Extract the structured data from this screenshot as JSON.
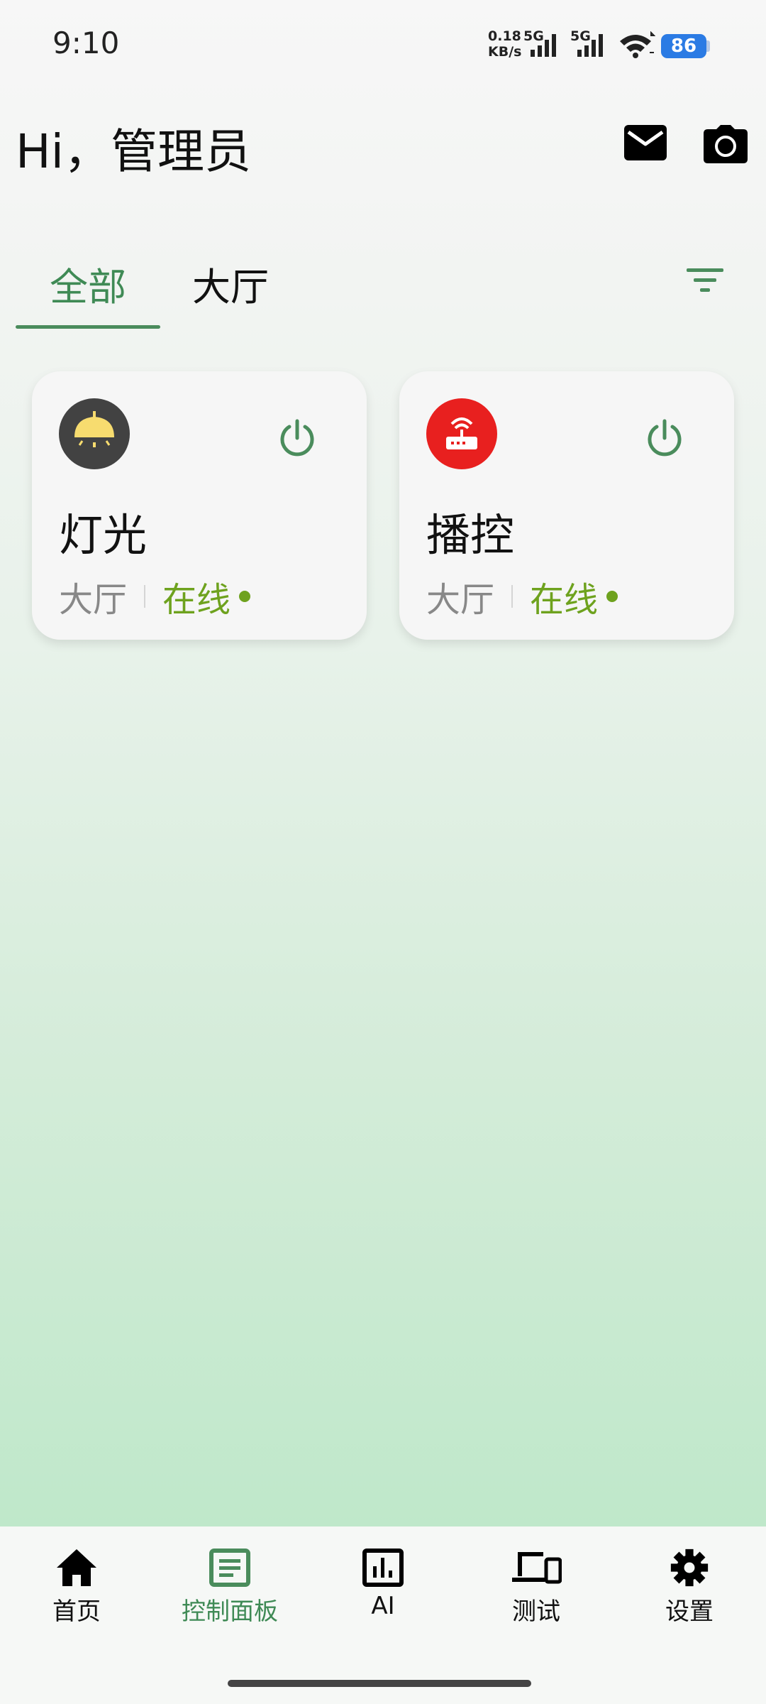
{
  "status_bar": {
    "time": "9:10",
    "net_speed_value": "0.18",
    "net_speed_unit": "KB/s",
    "sim1_label": "5G",
    "sim2_label": "5G",
    "battery": "86"
  },
  "header": {
    "greeting": "Hi，管理员",
    "icons": [
      "mail-icon",
      "camera-icon"
    ]
  },
  "tabs": [
    {
      "label": "全部",
      "active": true
    },
    {
      "label": "大厅",
      "active": false
    }
  ],
  "devices": [
    {
      "name": "灯光",
      "room": "大厅",
      "status": "在线",
      "icon": "lamp-icon",
      "icon_bg": "#424242",
      "icon_color": "#f7dc6f"
    },
    {
      "name": "播控",
      "room": "大厅",
      "status": "在线",
      "icon": "router-icon",
      "icon_bg": "#e8201f",
      "icon_color": "#ffffff"
    }
  ],
  "nav": [
    {
      "label": "首页",
      "icon": "home-icon",
      "active": false
    },
    {
      "label": "控制面板",
      "icon": "panel-icon",
      "active": true
    },
    {
      "label": "AI",
      "icon": "chart-icon",
      "active": false
    },
    {
      "label": "测试",
      "icon": "devices-icon",
      "active": false
    },
    {
      "label": "设置",
      "icon": "gear-icon",
      "active": false
    }
  ],
  "colors": {
    "accent": "#3f8a55",
    "online": "#6ea21e",
    "battery": "#2b7be4"
  }
}
